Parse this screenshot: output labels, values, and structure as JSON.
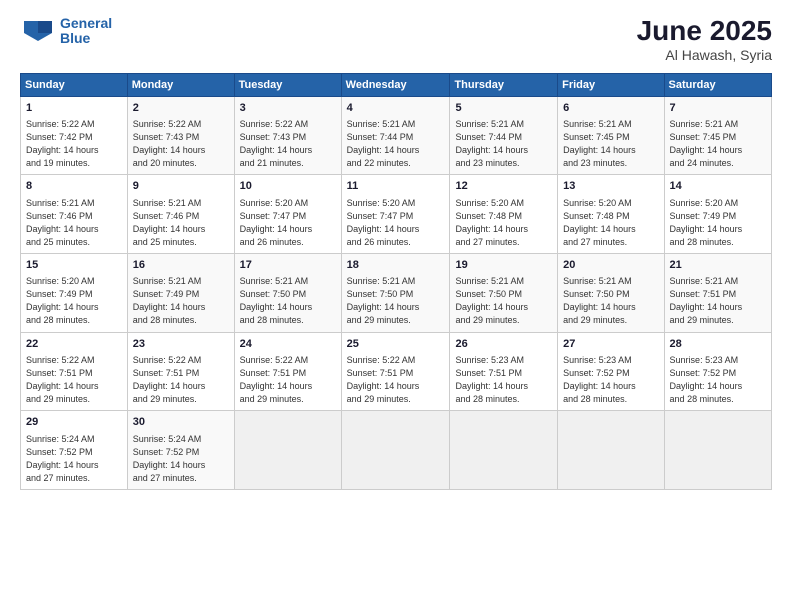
{
  "header": {
    "logo_line1": "General",
    "logo_line2": "Blue",
    "month_title": "June 2025",
    "location": "Al Hawash, Syria"
  },
  "columns": [
    "Sunday",
    "Monday",
    "Tuesday",
    "Wednesday",
    "Thursday",
    "Friday",
    "Saturday"
  ],
  "weeks": [
    [
      {
        "day": "1",
        "detail": "Sunrise: 5:22 AM\nSunset: 7:42 PM\nDaylight: 14 hours\nand 19 minutes."
      },
      {
        "day": "2",
        "detail": "Sunrise: 5:22 AM\nSunset: 7:43 PM\nDaylight: 14 hours\nand 20 minutes."
      },
      {
        "day": "3",
        "detail": "Sunrise: 5:22 AM\nSunset: 7:43 PM\nDaylight: 14 hours\nand 21 minutes."
      },
      {
        "day": "4",
        "detail": "Sunrise: 5:21 AM\nSunset: 7:44 PM\nDaylight: 14 hours\nand 22 minutes."
      },
      {
        "day": "5",
        "detail": "Sunrise: 5:21 AM\nSunset: 7:44 PM\nDaylight: 14 hours\nand 23 minutes."
      },
      {
        "day": "6",
        "detail": "Sunrise: 5:21 AM\nSunset: 7:45 PM\nDaylight: 14 hours\nand 23 minutes."
      },
      {
        "day": "7",
        "detail": "Sunrise: 5:21 AM\nSunset: 7:45 PM\nDaylight: 14 hours\nand 24 minutes."
      }
    ],
    [
      {
        "day": "8",
        "detail": "Sunrise: 5:21 AM\nSunset: 7:46 PM\nDaylight: 14 hours\nand 25 minutes."
      },
      {
        "day": "9",
        "detail": "Sunrise: 5:21 AM\nSunset: 7:46 PM\nDaylight: 14 hours\nand 25 minutes."
      },
      {
        "day": "10",
        "detail": "Sunrise: 5:20 AM\nSunset: 7:47 PM\nDaylight: 14 hours\nand 26 minutes."
      },
      {
        "day": "11",
        "detail": "Sunrise: 5:20 AM\nSunset: 7:47 PM\nDaylight: 14 hours\nand 26 minutes."
      },
      {
        "day": "12",
        "detail": "Sunrise: 5:20 AM\nSunset: 7:48 PM\nDaylight: 14 hours\nand 27 minutes."
      },
      {
        "day": "13",
        "detail": "Sunrise: 5:20 AM\nSunset: 7:48 PM\nDaylight: 14 hours\nand 27 minutes."
      },
      {
        "day": "14",
        "detail": "Sunrise: 5:20 AM\nSunset: 7:49 PM\nDaylight: 14 hours\nand 28 minutes."
      }
    ],
    [
      {
        "day": "15",
        "detail": "Sunrise: 5:20 AM\nSunset: 7:49 PM\nDaylight: 14 hours\nand 28 minutes."
      },
      {
        "day": "16",
        "detail": "Sunrise: 5:21 AM\nSunset: 7:49 PM\nDaylight: 14 hours\nand 28 minutes."
      },
      {
        "day": "17",
        "detail": "Sunrise: 5:21 AM\nSunset: 7:50 PM\nDaylight: 14 hours\nand 28 minutes."
      },
      {
        "day": "18",
        "detail": "Sunrise: 5:21 AM\nSunset: 7:50 PM\nDaylight: 14 hours\nand 29 minutes."
      },
      {
        "day": "19",
        "detail": "Sunrise: 5:21 AM\nSunset: 7:50 PM\nDaylight: 14 hours\nand 29 minutes."
      },
      {
        "day": "20",
        "detail": "Sunrise: 5:21 AM\nSunset: 7:50 PM\nDaylight: 14 hours\nand 29 minutes."
      },
      {
        "day": "21",
        "detail": "Sunrise: 5:21 AM\nSunset: 7:51 PM\nDaylight: 14 hours\nand 29 minutes."
      }
    ],
    [
      {
        "day": "22",
        "detail": "Sunrise: 5:22 AM\nSunset: 7:51 PM\nDaylight: 14 hours\nand 29 minutes."
      },
      {
        "day": "23",
        "detail": "Sunrise: 5:22 AM\nSunset: 7:51 PM\nDaylight: 14 hours\nand 29 minutes."
      },
      {
        "day": "24",
        "detail": "Sunrise: 5:22 AM\nSunset: 7:51 PM\nDaylight: 14 hours\nand 29 minutes."
      },
      {
        "day": "25",
        "detail": "Sunrise: 5:22 AM\nSunset: 7:51 PM\nDaylight: 14 hours\nand 29 minutes."
      },
      {
        "day": "26",
        "detail": "Sunrise: 5:23 AM\nSunset: 7:51 PM\nDaylight: 14 hours\nand 28 minutes."
      },
      {
        "day": "27",
        "detail": "Sunrise: 5:23 AM\nSunset: 7:52 PM\nDaylight: 14 hours\nand 28 minutes."
      },
      {
        "day": "28",
        "detail": "Sunrise: 5:23 AM\nSunset: 7:52 PM\nDaylight: 14 hours\nand 28 minutes."
      }
    ],
    [
      {
        "day": "29",
        "detail": "Sunrise: 5:24 AM\nSunset: 7:52 PM\nDaylight: 14 hours\nand 27 minutes."
      },
      {
        "day": "30",
        "detail": "Sunrise: 5:24 AM\nSunset: 7:52 PM\nDaylight: 14 hours\nand 27 minutes."
      },
      {
        "day": "",
        "detail": ""
      },
      {
        "day": "",
        "detail": ""
      },
      {
        "day": "",
        "detail": ""
      },
      {
        "day": "",
        "detail": ""
      },
      {
        "day": "",
        "detail": ""
      }
    ]
  ]
}
